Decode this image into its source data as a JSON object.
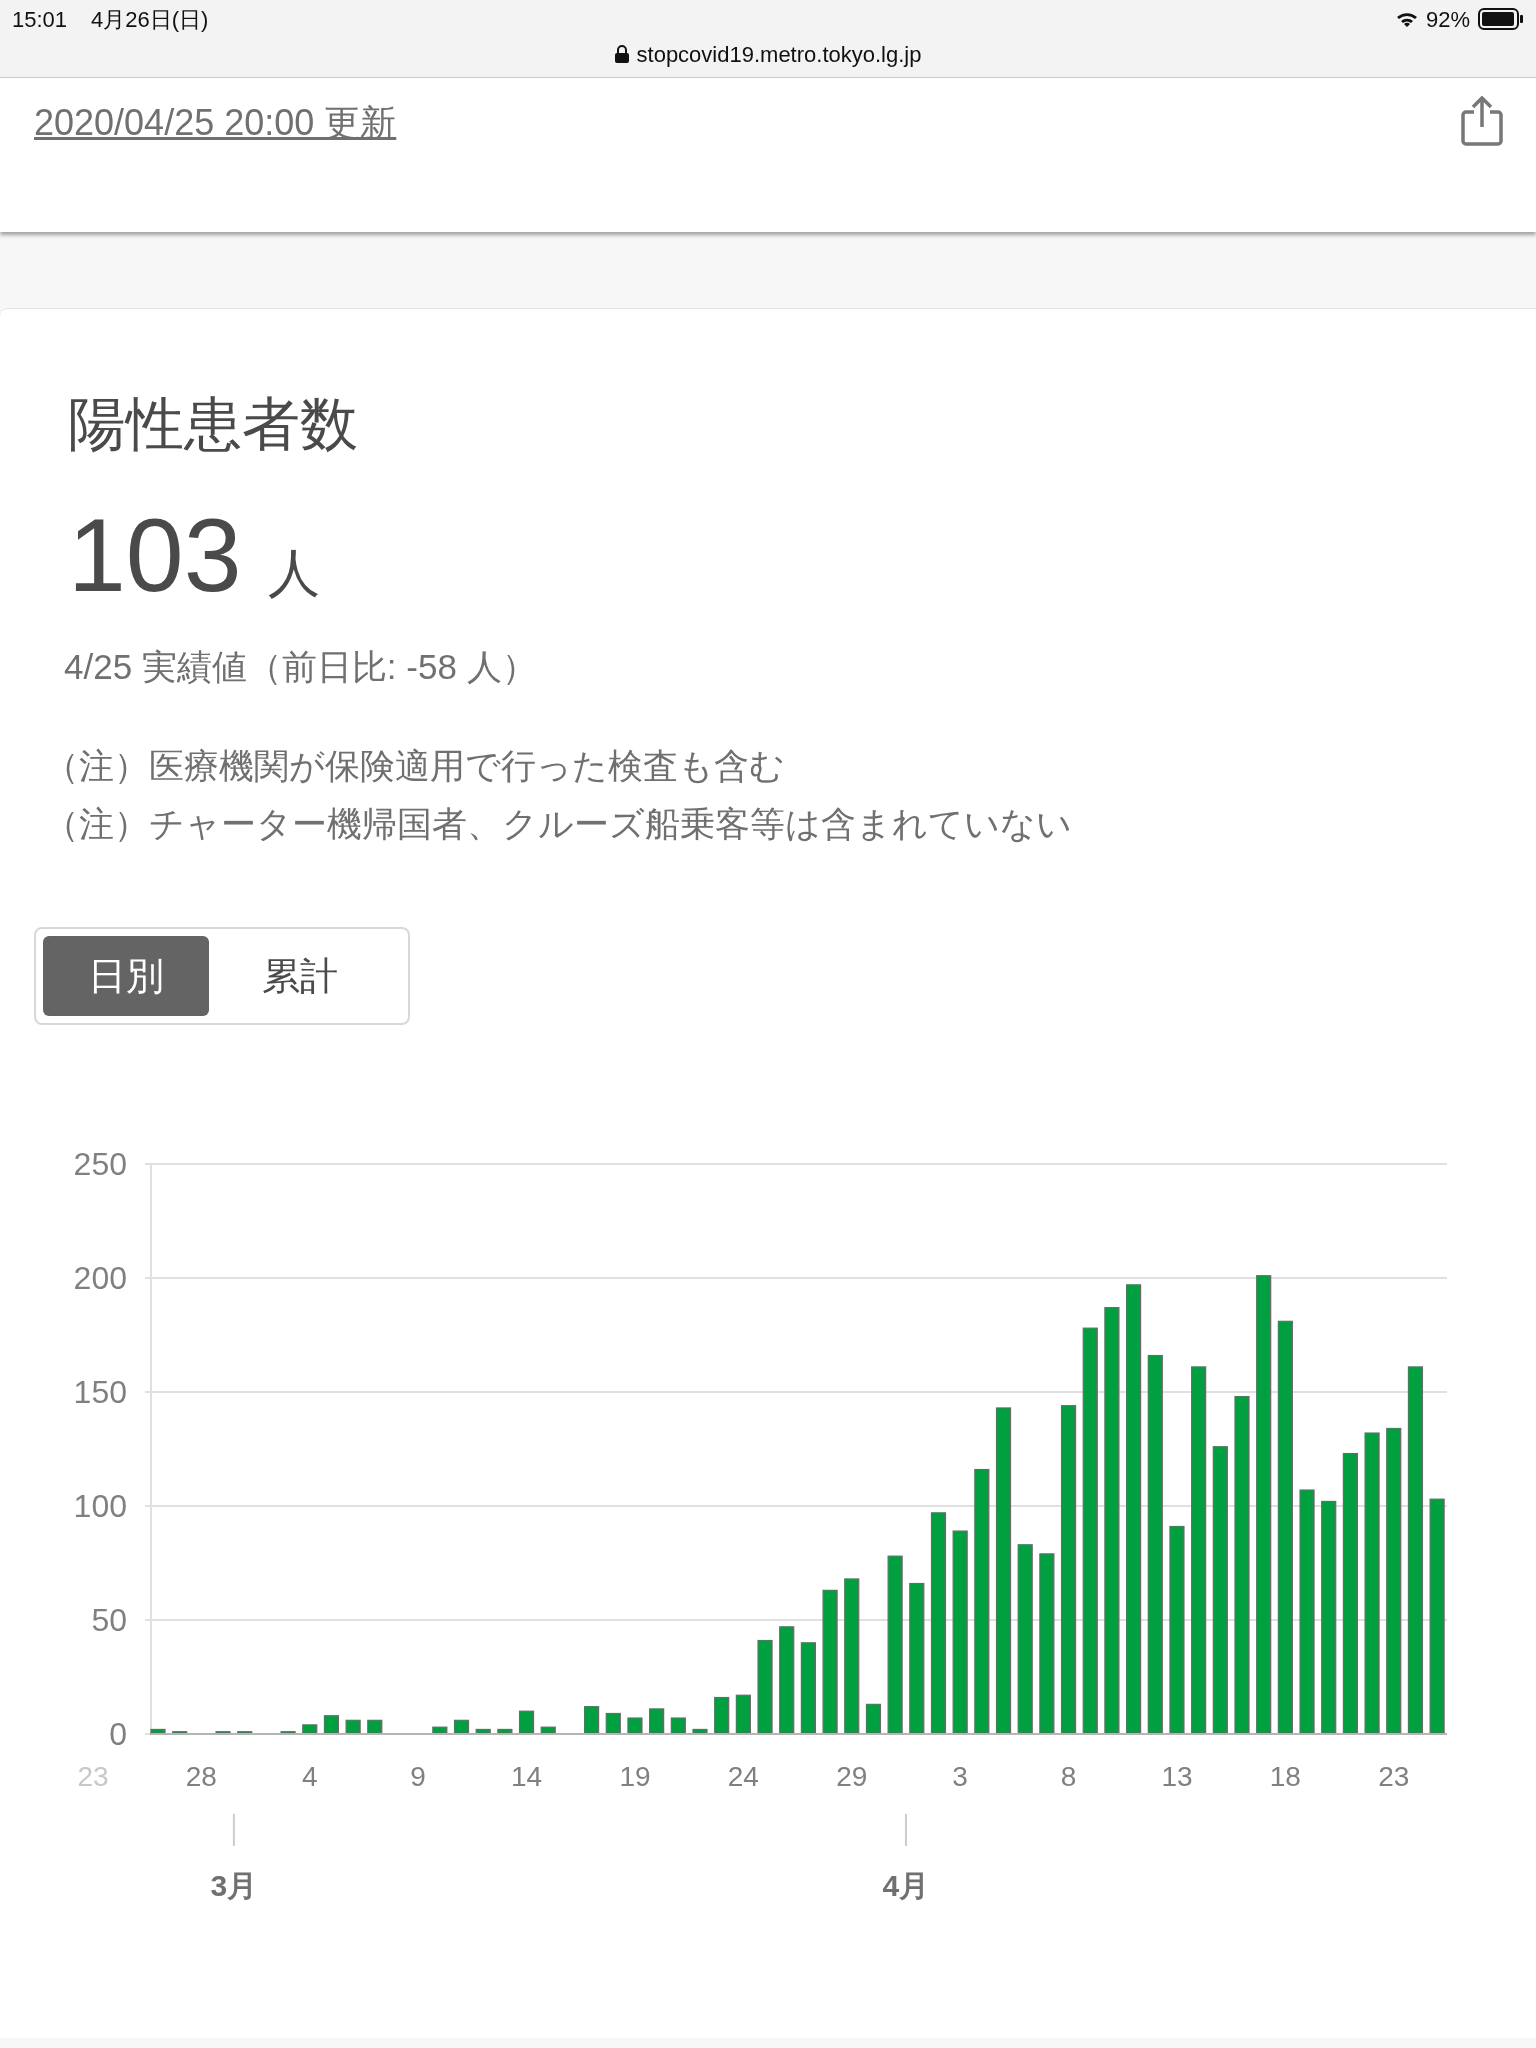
{
  "status_bar": {
    "time": "15:01",
    "date": "4月26日(日)",
    "url": "stopcovid19.metro.tokyo.lg.jp",
    "battery": "92%"
  },
  "header": {
    "updated": "2020/04/25 20:00 更新"
  },
  "card": {
    "title": "陽性患者数",
    "value": "103",
    "unit": "人",
    "subtitle": "4/25 実績値（前日比: -58 人）",
    "notes": [
      "（注）医療機関が保険適用で行った検査も含む",
      "（注）チャーター機帰国者、クルーズ船乗客等は含まれていない"
    ],
    "tabs": [
      {
        "label": "日別",
        "selected": true
      },
      {
        "label": "累計",
        "selected": false
      }
    ],
    "chart_data": {
      "type": "bar",
      "categories": [
        null,
        null,
        "28",
        null,
        null,
        null,
        null,
        "4",
        null,
        null,
        null,
        null,
        "9",
        null,
        null,
        null,
        null,
        "14",
        null,
        null,
        null,
        null,
        "19",
        null,
        null,
        null,
        null,
        "24",
        null,
        null,
        null,
        null,
        "29",
        null,
        null,
        null,
        null,
        "3",
        null,
        null,
        null,
        null,
        "8",
        null,
        null,
        null,
        null,
        "13",
        null,
        null,
        null,
        null,
        "18",
        null,
        null,
        null,
        null,
        "23",
        null,
        null
      ],
      "grid": true,
      "series": [
        {
          "color": "#00a040",
          "values": [
            2,
            1,
            0,
            1,
            1,
            0,
            1,
            4,
            8,
            6,
            6,
            0,
            0,
            3,
            6,
            2,
            2,
            10,
            3,
            0,
            12,
            9,
            7,
            11,
            7,
            2,
            16,
            17,
            41,
            47,
            40,
            63,
            68,
            13,
            78,
            66,
            97,
            89,
            116,
            143,
            83,
            79,
            144,
            178,
            187,
            197,
            166,
            91,
            161,
            126,
            148,
            201,
            181,
            107,
            102,
            123,
            132,
            134,
            161,
            103
          ]
        }
      ],
      "ylim": [
        0,
        250
      ],
      "yticks": [
        0,
        50,
        100,
        150,
        200,
        250
      ],
      "annotations": [
        "3月",
        "4月"
      ]
    },
    "faded_axis_label": "23"
  }
}
